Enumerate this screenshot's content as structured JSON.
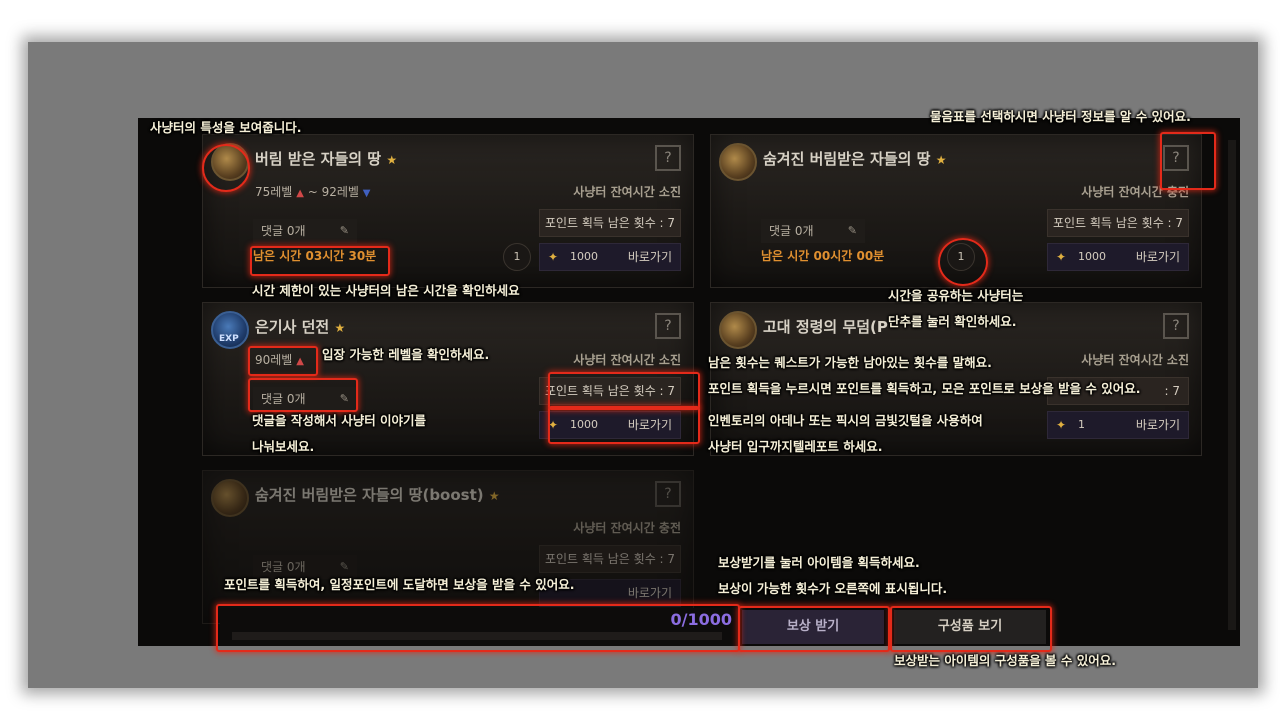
{
  "cards": [
    {
      "title": "버림 받은 자들의 땅",
      "level_min": "75레벨",
      "level_max": "~ 92레벨",
      "time_status": "사냥터 잔여시간 소진",
      "comment": "댓글 0개",
      "points": "포인트 획득 남은 횟수 : 7",
      "reward_value": "1000",
      "goto": "바로가기",
      "remaining": "남은 시간 03시간 30분",
      "share_count": "1"
    },
    {
      "title": "숨겨진 버림받은 자들의 땅",
      "time_status": "사냥터 잔여시간 충전",
      "comment": "댓글 0개",
      "points": "포인트 획득 남은 횟수 : 7",
      "reward_value": "1000",
      "goto": "바로가기",
      "remaining": "남은 시간 00시간 00분",
      "share_count": "1"
    },
    {
      "title": "은기사 던전",
      "level": "90레벨",
      "time_status": "사냥터 잔여시간 소진",
      "comment": "댓글 0개",
      "points": "포인트 획득 남은 횟수 : 7",
      "reward_value": "1000",
      "goto": "바로가기",
      "exp_badge": "EXP"
    },
    {
      "title": "고대 정령의 무덤(P",
      "time_status": "사냥터 잔여시간 소진",
      "points_partial": ": 7",
      "reward_value": "1",
      "goto": "바로가기"
    },
    {
      "title": "숨겨진 버림받은 자들의 땅(boost)",
      "time_status": "사냥터 잔여시간 충전",
      "comment": "댓글 0개",
      "points": "포인트 획득 남은 횟수 : 7",
      "goto": "바로가기"
    }
  ],
  "question_mark": "?",
  "star": "★",
  "progress": {
    "value": "0/1000",
    "fraction": 0
  },
  "buttons": {
    "reward": "보상 받기",
    "components": "구성품 보기"
  },
  "annotations": {
    "traits": "사냥터의 특성을 보여줍니다.",
    "question": "물음표를 선택하시면 사냥터 정보를 알 수 있어요.",
    "remaining_time": "시간 제한이 있는 사냥터의 남은 시간을 확인하세요",
    "share_line1": "시간을 공유하는 사냥터는",
    "share_line2": "단추를 눌러 확인하세요.",
    "level": "입장 가능한 레벨을 확인하세요.",
    "count": "남은 횟수는 퀘스트가 가능한 남아있는 횟수를 말해요.",
    "points": "포인트 획득을 누르시면 포인트를 획득하고, 모은 포인트로 보상을 받을 수 있어요.",
    "comment_line1": "댓글을 작성해서 사냥터 이야기를",
    "comment_line2": "나눠보세요.",
    "teleport_line1": "인벤토리의 아데나 또는 픽시의 금빛깃털을 사용하여",
    "teleport_line2": "사냥터 입구까지텔레포트 하세요.",
    "reward_line1": "보상받기를 눌러 아이템을 획득하세요.",
    "reward_line2": "보상이 가능한 횟수가 오른쪽에 표시됩니다.",
    "progress": "포인트를 획득하여, 일정포인트에 도달하면 보상을 받을 수 있어요.",
    "components": "보상받는 아이템의 구성품을 볼 수 있어요."
  }
}
